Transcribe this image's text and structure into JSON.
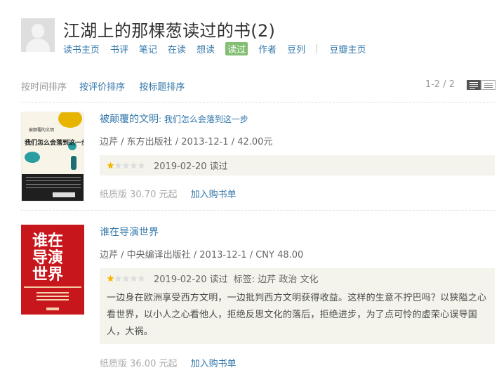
{
  "header": {
    "title": "江湖上的那棵葱读过的书(2)",
    "nav": [
      {
        "label": "读书主页",
        "active": false
      },
      {
        "label": "书评",
        "active": false
      },
      {
        "label": "笔记",
        "active": false
      },
      {
        "label": "在读",
        "active": false
      },
      {
        "label": "想读",
        "active": false
      },
      {
        "label": "读过",
        "active": true
      },
      {
        "label": "作者",
        "active": false
      },
      {
        "label": "豆列",
        "active": false
      }
    ],
    "nav_separator": "|",
    "nav_extra": "豆瓣主页"
  },
  "sortbar": {
    "current": "按时间排序",
    "by_rating": "按评价排序",
    "by_title": "按标题排序",
    "count": "1-2 / 2",
    "view_modes": [
      "list-view-icon",
      "compact-view-icon"
    ]
  },
  "colors": {
    "link": "#3377aa",
    "active_tab_bg": "#83bf73",
    "rating_bg": "#f4f4ec",
    "star_on": "#f7b500",
    "star_off": "#dddddd"
  },
  "books": [
    {
      "title": "被颠覆的文明",
      "subtitle": ": 我们怎么会落到这一步",
      "pub": "边芹 / 东方出版社 / 2013-12-1 / 42.00元",
      "rating": 1,
      "date_status": "2019-02-20 读过",
      "tags": "",
      "comment": "",
      "price": "纸质版 30.70 元起",
      "buy_label": "加入购书单",
      "cover": {
        "small_title": "被颠覆的文明",
        "main_title": "我们怎么会落到这一步"
      }
    },
    {
      "title": "谁在导演世界",
      "subtitle": "",
      "pub": "边芹 / 中央编译出版社 / 2013-12-1 / CNY 48.00",
      "rating": 1,
      "date_status": "2019-02-20 读过",
      "tags": "标签: 边芹 政治 文化",
      "comment": "一边身在欧洲享受西方文明，一边批判西方文明获得收益。这样的生意不拧巴吗？以狭隘之心看世界，以小人之心看他人，拒绝反思文化的落后，拒绝进步，为了点可怜的虚荣心误导国人，大祸。",
      "price": "纸质版 36.00 元起",
      "buy_label": "加入购书单",
      "cover": {
        "main_title": "谁在导演世界"
      }
    }
  ]
}
